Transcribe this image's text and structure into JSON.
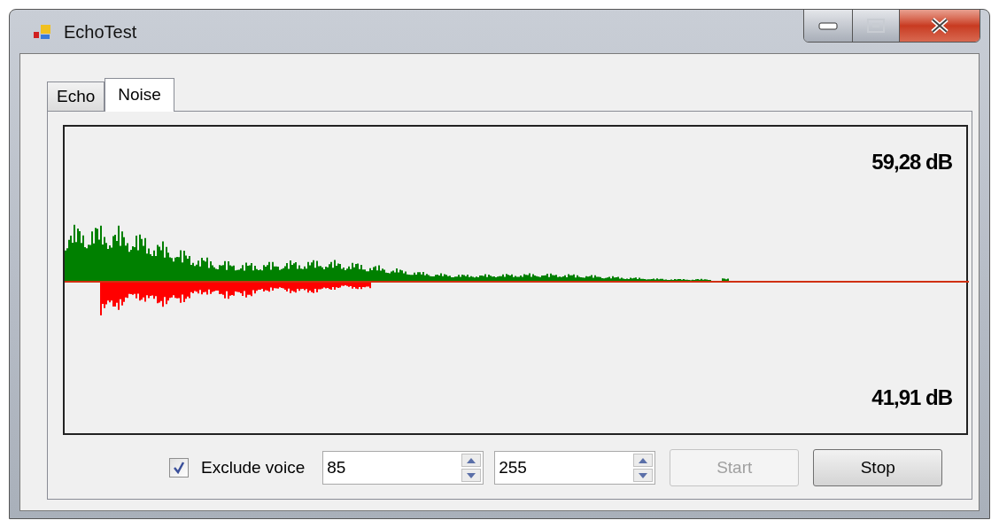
{
  "window": {
    "title": "EchoTest"
  },
  "tabs": [
    {
      "label": "Echo",
      "selected": false
    },
    {
      "label": "Noise",
      "selected": true
    }
  ],
  "meter": {
    "max_reading": "59,28 dB",
    "min_reading": "41,91 dB"
  },
  "controls": {
    "exclude_voice": {
      "label": "Exclude voice",
      "checked": true
    },
    "spinners": [
      {
        "value": "85"
      },
      {
        "value": "255"
      }
    ],
    "buttons": [
      {
        "label": "Start",
        "disabled": true
      },
      {
        "label": "Stop",
        "disabled": false
      }
    ]
  }
}
